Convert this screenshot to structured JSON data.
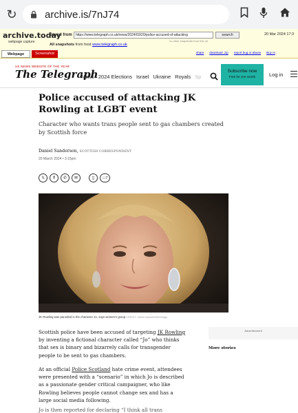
{
  "browser": {
    "url": "archive.is/7nJ74",
    "reload_icon": "reload-icon",
    "lock_icon": "lock-icon",
    "bookmark_icon": "bookmark-icon",
    "mic_icon": "mic-icon",
    "home_icon": "home-icon"
  },
  "archive": {
    "logo": "archive.today",
    "logo_sub": "webpage capture",
    "saved_from_label": "Saved from",
    "saved_url": "https://www.telegraph.co.uk/news/2024/03/20/police-accused-of-attacking",
    "search_label": "search",
    "saved_date": "20 Mar 2024 17:3",
    "other_snapshots": "no other snapshots from this url",
    "all_snapshots_label": "All snapshots",
    "from_host_label": "from host",
    "host_link": "www.telegraph.co.uk",
    "tab_webpage": "Webpage",
    "tab_screenshot": "Screenshot",
    "actions": [
      "share",
      "download .zip",
      "report bug or abuse",
      "Buy m"
    ]
  },
  "telegraph": {
    "kicker": "UK NEWS WEBSITE OF THE YEAR",
    "brand": "The Telegraph",
    "nav": [
      "News",
      "2024 Elections",
      "Israel",
      "Ukraine",
      "Royals",
      "Sp"
    ],
    "subscribe": "Subscribe now",
    "subscribe_sub": "Free for one month",
    "login": "Log in"
  },
  "article": {
    "headline": "Police accused of attacking JK Rowling at LGBT event",
    "standfirst": "Character who wants trans people sent to gas chambers created by Scottish force",
    "author": "Daniel Sanderson,",
    "author_role": "SCOTTISH CORRESPONDENT",
    "date": "20 March 2024 • 3:15pm",
    "comment_count": "7",
    "caption": "JK Rowling was parodied in the character Jo, says women's group",
    "caption_credit": "CREDIT: Samir Hussein/WireImage",
    "p1_a": "Scottish police have been accused of targeting ",
    "p1_link": "JK Rowling",
    "p1_b": " by inventing a fictional character called “Jo” who thinks that sex is binary and bizarrely calls for transgender people to be sent to gas chambers.",
    "p2_a": "At an official ",
    "p2_link": "Police Scotland",
    "p2_b": " hate crime event, attendees were presented with a “scenario” in which Jo is described as a passionate gender critical campaigner, who like Rowling believes people cannot change sex and has a large social media following.",
    "p3": "Jo is then reported for declaring “I think all trans"
  },
  "sidebar": {
    "advertisement": "Advertisement",
    "more_stories": "More stories"
  }
}
